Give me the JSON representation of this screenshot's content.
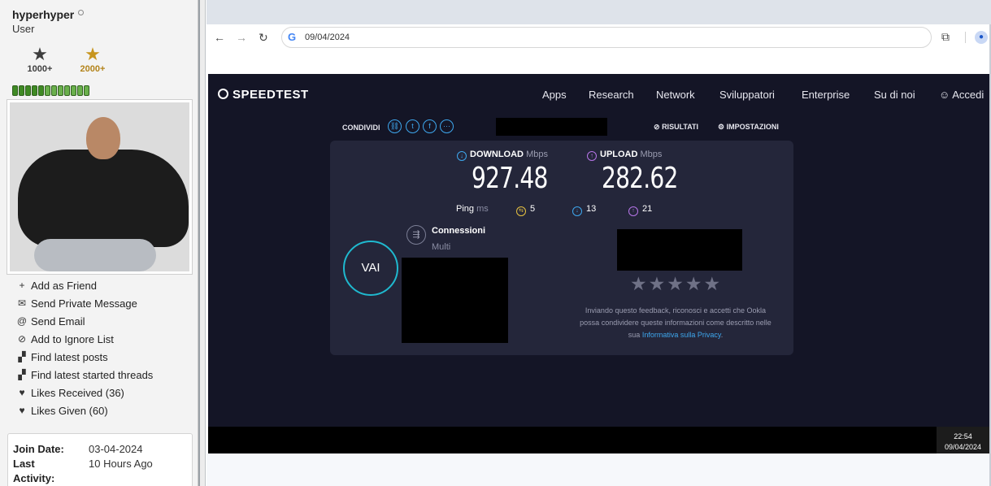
{
  "profile": {
    "username": "hyperhyper",
    "user_title": "User",
    "awards": [
      {
        "icon": "dark-star-icon",
        "label": "1000+"
      },
      {
        "icon": "gold-star-icon",
        "label": "2000+"
      }
    ],
    "actions": [
      {
        "icon": "add-icon",
        "label": "Add as Friend"
      },
      {
        "icon": "envelope-icon",
        "label": "Send Private Message"
      },
      {
        "icon": "at-icon",
        "label": "Send Email"
      },
      {
        "icon": "ignore-icon",
        "label": "Add to Ignore List"
      },
      {
        "icon": "posts-icon",
        "label": "Find latest posts"
      },
      {
        "icon": "threads-icon",
        "label": "Find latest started threads"
      },
      {
        "icon": "heart-icon",
        "label": "Likes Received (36)"
      },
      {
        "icon": "heart-icon",
        "label": "Likes Given (60)"
      }
    ],
    "info": {
      "join_label": "Join Date:",
      "join_value": "03-04-2024",
      "last_label_1": "Last",
      "last_label_2": "Activity:",
      "last_value": "10 Hours Ago"
    }
  },
  "browser": {
    "address": "09/04/2024"
  },
  "speedtest": {
    "logo": "SPEEDTEST",
    "nav": [
      "Apps",
      "Research",
      "Network",
      "Sviluppatori",
      "Enterprise",
      "Su di noi",
      "Accedi"
    ],
    "share_label": "CONDIVIDI",
    "results_label": "RISULTATI",
    "settings_label": "IMPOSTAZIONI",
    "download_label": "DOWNLOAD",
    "download_unit": "Mbps",
    "download_value": "927.48",
    "upload_label": "UPLOAD",
    "upload_unit": "Mbps",
    "upload_value": "282.62",
    "ping_label": "Ping",
    "ping_unit": "ms",
    "ping_idle": "5",
    "ping_download": "13",
    "ping_upload": "21",
    "go_label": "VAI",
    "connections_title": "Connessioni",
    "connections_value": "Multi",
    "feedback_text": "Inviando questo feedback, riconosci e accetti che Ookla possa condividere queste informazioni come descritto nelle sua",
    "privacy_link": "Informativa sulla Privacy",
    "colors": {
      "accent": "#1fb9cf",
      "download": "#3ea7ee",
      "upload": "#b675e8",
      "background": "#141526"
    }
  },
  "taskbar": {
    "time": "22:54",
    "date": "09/04/2024"
  }
}
